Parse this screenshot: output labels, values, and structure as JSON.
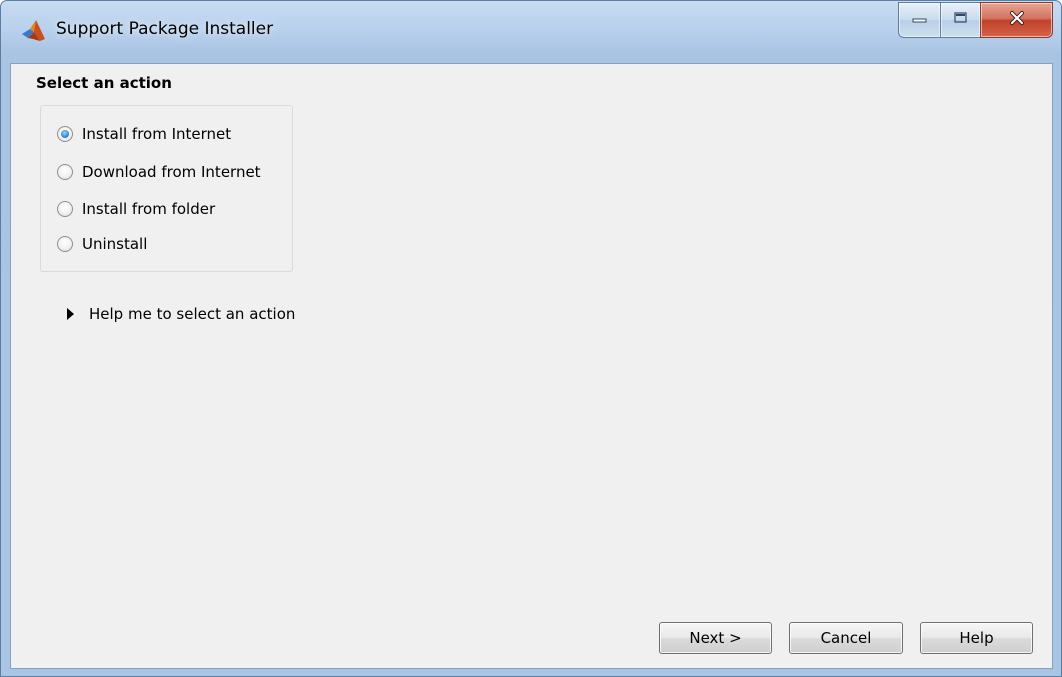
{
  "window": {
    "title": "Support Package Installer"
  },
  "icons": {
    "app": "matlab-logo-icon",
    "minimize": "minimize-icon",
    "maximize": "maximize-icon",
    "close": "close-icon",
    "expander": "triangle-right-icon"
  },
  "colors": {
    "frame": "#aac5e4",
    "client_background": "#f0f0f0",
    "close_button": "#c7472f",
    "radio_selected": "#3a8fd0"
  },
  "action_section": {
    "heading": "Select an action",
    "options": [
      {
        "label": "Install from Internet",
        "selected": true
      },
      {
        "label": "Download from Internet",
        "selected": false
      },
      {
        "label": "Install from folder",
        "selected": false
      },
      {
        "label": "Uninstall",
        "selected": false
      }
    ]
  },
  "help_expander": {
    "label": "Help me to select an action",
    "expanded": false
  },
  "buttons": {
    "next": "Next >",
    "cancel": "Cancel",
    "help": "Help"
  }
}
